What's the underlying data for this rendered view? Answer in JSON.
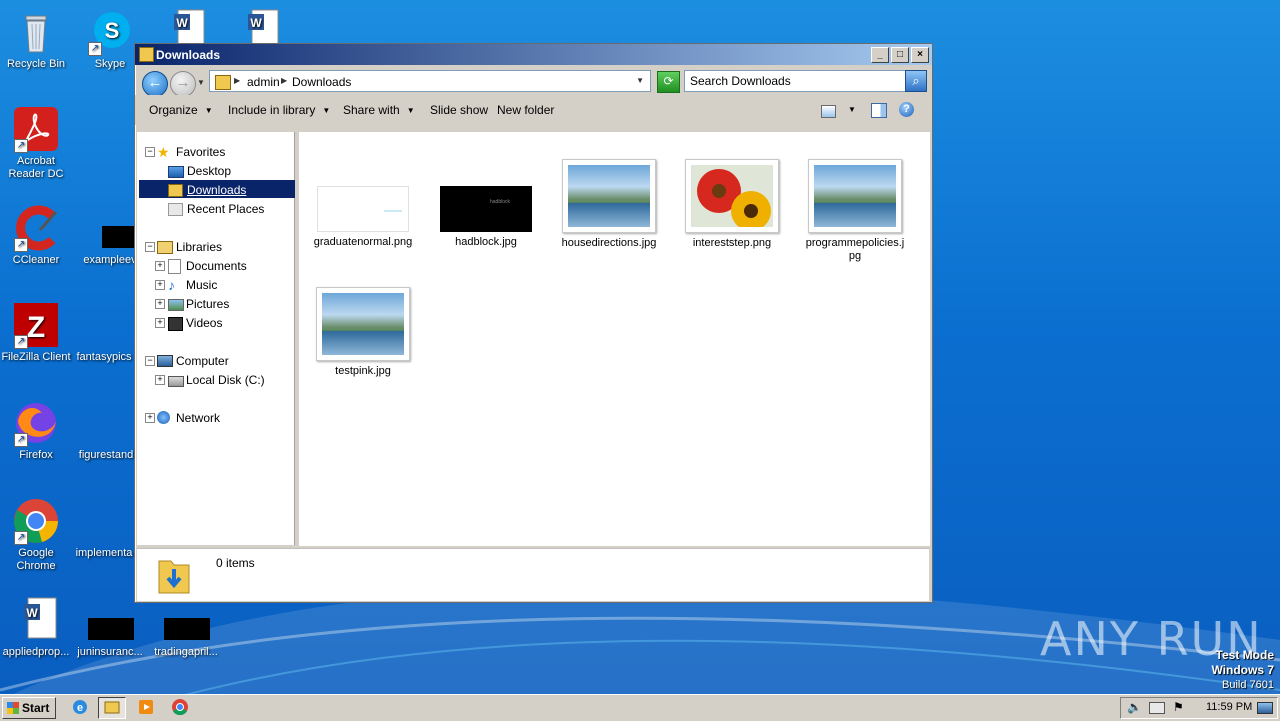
{
  "desktop": {
    "icons": [
      {
        "label": "Recycle Bin"
      },
      {
        "label": "Skype"
      },
      {
        "label": "Acrobat Reader DC"
      },
      {
        "label": "CCleaner"
      },
      {
        "label": "exampleev"
      },
      {
        "label": "FileZilla Client"
      },
      {
        "label": "fantasypics"
      },
      {
        "label": "Firefox"
      },
      {
        "label": "figurestand"
      },
      {
        "label": "Google Chrome"
      },
      {
        "label": "implementa"
      },
      {
        "label": "appliedprop..."
      },
      {
        "label": "juninsuranc..."
      },
      {
        "label": "tradingapril..."
      }
    ],
    "watermark": "ANY RUN",
    "test_mode": {
      "line1": "Test Mode",
      "line2": "Windows 7",
      "line3": "Build 7601"
    }
  },
  "window": {
    "title": "Downloads",
    "address": {
      "crumbs": [
        "admin",
        "Downloads"
      ]
    },
    "search": {
      "placeholder": "Search Downloads"
    },
    "toolbar": {
      "organize": "Organize",
      "include_in_library": "Include in library",
      "share_with": "Share with",
      "slide_show": "Slide show",
      "new_folder": "New folder"
    },
    "nav": {
      "favorites": "Favorites",
      "desktop": "Desktop",
      "downloads": "Downloads",
      "recent_places": "Recent Places",
      "libraries": "Libraries",
      "documents": "Documents",
      "music": "Music",
      "pictures": "Pictures",
      "videos": "Videos",
      "computer": "Computer",
      "local_disk": "Local Disk (C:)",
      "network": "Network"
    },
    "files": [
      {
        "name": "graduatenormal.png"
      },
      {
        "name": "hadblock.jpg"
      },
      {
        "name": "housedirections.jpg"
      },
      {
        "name": "intereststep.png"
      },
      {
        "name": "programmepolicies.jpg"
      },
      {
        "name": "testpink.jpg"
      }
    ],
    "hadblock_thumb_text": "hadblock",
    "status": "0 items"
  },
  "taskbar": {
    "start": "Start",
    "clock": "11:59 PM"
  }
}
